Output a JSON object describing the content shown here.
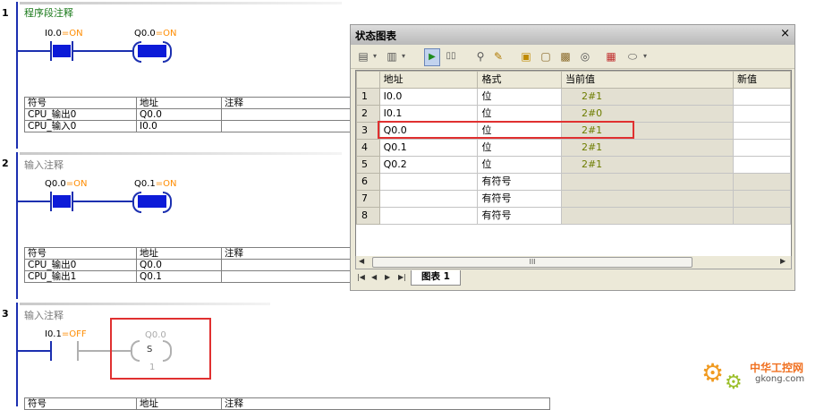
{
  "networks": [
    {
      "number": "1",
      "title": "程序段注释",
      "contact": {
        "address": "I0.0",
        "state": "=ON"
      },
      "coil": {
        "address": "Q0.0",
        "state": "=ON"
      },
      "symbols": {
        "headers": [
          "符号",
          "地址",
          "注释"
        ],
        "rows": [
          [
            "CPU_输出0",
            "Q0.0"
          ],
          [
            "CPU_输入0",
            "I0.0"
          ]
        ]
      }
    },
    {
      "number": "2",
      "title": "输入注释",
      "contact": {
        "address": "Q0.0",
        "state": "=ON"
      },
      "coil": {
        "address": "Q0.1",
        "state": "=ON"
      },
      "symbols": {
        "headers": [
          "符号",
          "地址",
          "注释"
        ],
        "rows": [
          [
            "CPU_输出0",
            "Q0.0"
          ],
          [
            "CPU_输出1",
            "Q0.1"
          ]
        ]
      }
    },
    {
      "number": "3",
      "title": "输入注释",
      "contact": {
        "address": "I0.1",
        "state": "=OFF"
      },
      "coil": {
        "address": "Q0.0",
        "instr": "S",
        "count": "1"
      },
      "symbols": {
        "headers": [
          "符号",
          "地址",
          "注释"
        ]
      }
    }
  ],
  "status_chart": {
    "title": "状态图表",
    "close": "×",
    "columns": [
      "地址",
      "格式",
      "当前值",
      "新值"
    ],
    "rows": [
      {
        "n": "1",
        "addr": "I0.0",
        "fmt": "位",
        "val": "2#1"
      },
      {
        "n": "2",
        "addr": "I0.1",
        "fmt": "位",
        "val": "2#0"
      },
      {
        "n": "3",
        "addr": "Q0.0",
        "fmt": "位",
        "val": "2#1"
      },
      {
        "n": "4",
        "addr": "Q0.1",
        "fmt": "位",
        "val": "2#1"
      },
      {
        "n": "5",
        "addr": "Q0.2",
        "fmt": "位",
        "val": "2#1"
      },
      {
        "n": "6",
        "addr": "",
        "fmt": "有符号",
        "val": ""
      },
      {
        "n": "7",
        "addr": "",
        "fmt": "有符号",
        "val": ""
      },
      {
        "n": "8",
        "addr": "",
        "fmt": "有符号",
        "val": ""
      }
    ],
    "tab_label": "图表 1",
    "scroll_grip": "III"
  },
  "watermark": {
    "name": "中华工控网",
    "url": "gkong.com"
  },
  "colors": {
    "highlight": "#e03030",
    "ladder": "#1b2fb0",
    "on": "#ff8c00",
    "value": "#6d7d00"
  }
}
